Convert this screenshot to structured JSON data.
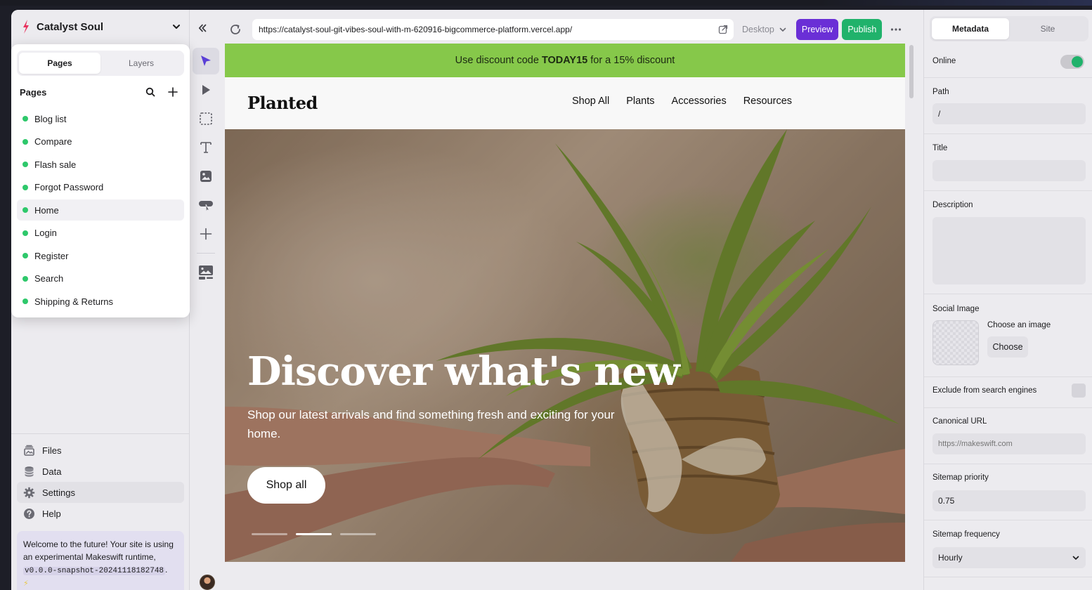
{
  "site": {
    "name": "Catalyst Soul"
  },
  "left_panel": {
    "tabs": [
      {
        "label": "Pages",
        "active": true
      },
      {
        "label": "Layers",
        "active": false
      }
    ],
    "section_title": "Pages",
    "pages": [
      {
        "label": "Blog list",
        "selected": false
      },
      {
        "label": "Compare",
        "selected": false
      },
      {
        "label": "Flash sale",
        "selected": false
      },
      {
        "label": "Forgot Password",
        "selected": false
      },
      {
        "label": "Home",
        "selected": true
      },
      {
        "label": "Login",
        "selected": false
      },
      {
        "label": "Register",
        "selected": false
      },
      {
        "label": "Search",
        "selected": false
      },
      {
        "label": "Shipping & Returns",
        "selected": false
      }
    ],
    "nav": [
      {
        "label": "Files",
        "icon": "files-icon"
      },
      {
        "label": "Data",
        "icon": "database-icon"
      },
      {
        "label": "Settings",
        "icon": "gear-icon"
      },
      {
        "label": "Help",
        "icon": "help-icon"
      }
    ],
    "notice": {
      "text": "Welcome to the future! Your site is using an experimental Makeswift runtime,",
      "version": "v0.0.0-snapshot-20241118182748",
      "suffix": "."
    }
  },
  "toolbar": {
    "url": "https://catalyst-soul-git-vibes-soul-with-m-620916-bigcommerce-platform.vercel.app/",
    "device": "Desktop",
    "preview_label": "Preview",
    "publish_label": "Publish"
  },
  "canvas": {
    "promo": {
      "prefix": "Use discount code",
      "code": "TODAY15",
      "suffix": "for a 15% discount"
    },
    "brand": "Planted",
    "nav": [
      "Shop All",
      "Plants",
      "Accessories",
      "Resources"
    ],
    "hero": {
      "title": "Discover what's new",
      "subtitle": "Shop our latest arrivals and find something fresh and exciting for your home.",
      "cta": "Shop all",
      "slide_count": 3,
      "active_slide": 2
    }
  },
  "right_panel": {
    "tabs": [
      {
        "label": "Metadata",
        "active": true
      },
      {
        "label": "Site",
        "active": false
      }
    ],
    "online_label": "Online",
    "online": true,
    "path_label": "Path",
    "path_value": "/",
    "title_label": "Title",
    "title_value": "",
    "description_label": "Description",
    "description_value": "",
    "social_image_label": "Social Image",
    "choose_image_label": "Choose an image",
    "choose_button": "Choose",
    "exclude_label": "Exclude from search engines",
    "exclude": false,
    "canonical_label": "Canonical URL",
    "canonical_placeholder": "https://makeswift.com",
    "priority_label": "Sitemap priority",
    "priority_value": "0.75",
    "frequency_label": "Sitemap frequency",
    "frequency_value": "Hourly"
  },
  "colors": {
    "accent_purple": "#6a2fd6",
    "accent_green": "#20b26b",
    "promo_green": "#86c84a",
    "page_dot": "#2ec86b"
  }
}
